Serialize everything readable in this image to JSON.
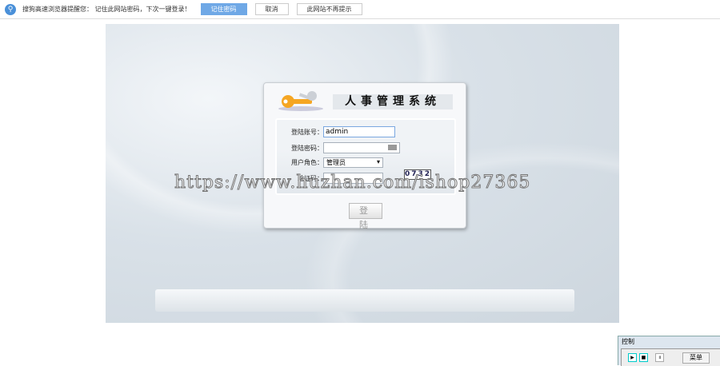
{
  "browser_bar": {
    "message": "搜狗高速浏览器提醒您： 记住此网站密码，下次一键登录！",
    "remember": "记住密码",
    "cancel": "取消",
    "never": "此网站不再提示",
    "icon": "key-icon"
  },
  "login": {
    "title": "人事管理系统",
    "account_label": "登陆账号：",
    "account_value": "admin",
    "password_label": "登陆密码：",
    "password_value": "",
    "role_label": "用户角色：",
    "role_value": "管理员",
    "captcha_label": "验证码：",
    "captcha_value": "",
    "captcha_image": "0732",
    "submit": "登 陆"
  },
  "watermark": "https://www.huzhan.com/ishop27365",
  "control": {
    "title": "控制",
    "menu": "菜单"
  }
}
